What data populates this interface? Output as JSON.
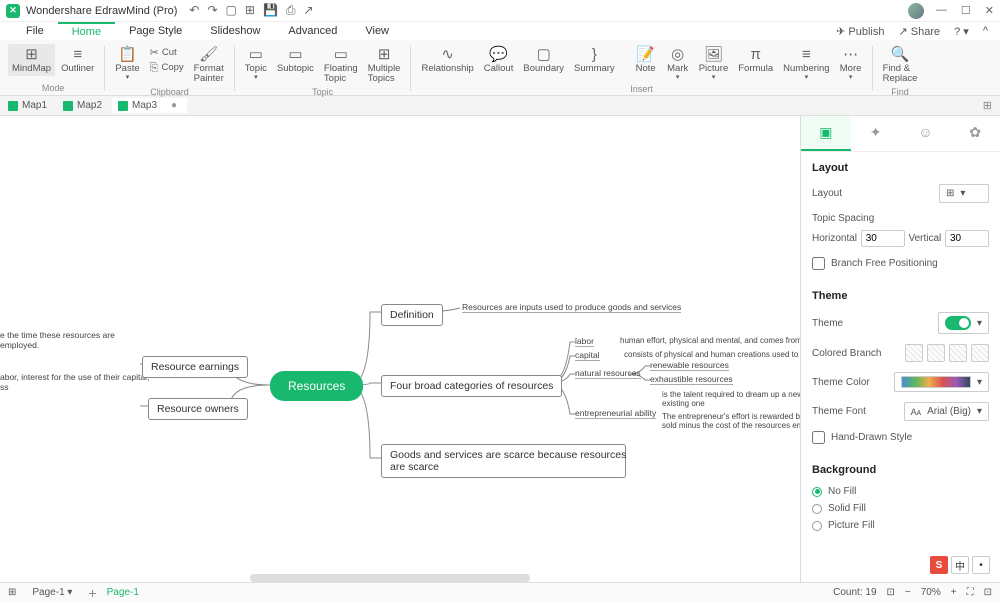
{
  "app": {
    "title": "Wondershare EdrawMind (Pro)"
  },
  "menu": {
    "items": [
      "File",
      "Home",
      "Page Style",
      "Slideshow",
      "Advanced",
      "View"
    ],
    "active": 1,
    "publish": "Publish",
    "share": "Share"
  },
  "ribbon": {
    "mode": {
      "label": "Mode",
      "mindmap": "MindMap",
      "outliner": "Outliner"
    },
    "clipboard": {
      "label": "Clipboard",
      "paste": "Paste",
      "cut": "Cut",
      "copy": "Copy",
      "painter": "Format\nPainter"
    },
    "topic": {
      "label": "Topic",
      "topic": "Topic",
      "subtopic": "Subtopic",
      "floating": "Floating\nTopic",
      "multiple": "Multiple\nTopics"
    },
    "insert": {
      "label": "Insert",
      "relationship": "Relationship",
      "callout": "Callout",
      "boundary": "Boundary",
      "summary": "Summary",
      "note": "Note",
      "mark": "Mark",
      "picture": "Picture",
      "formula": "Formula",
      "numbering": "Numbering",
      "more": "More"
    },
    "find": {
      "label": "Find",
      "find": "Find &\nReplace"
    }
  },
  "tabs": [
    "Map1",
    "Map2",
    "Map3"
  ],
  "mindmap": {
    "center": "Resources",
    "l1": "Resource earnings",
    "l2": "Resource owners",
    "note_l1": "e the time these resources are employed.",
    "note_l2": "abor, interest for the use of their capital,\nss",
    "r1": "Definition",
    "r1_note": "Resources are inputs used to produce goods and services",
    "r2": "Four broad categories of resources",
    "r2_items": {
      "labor": "labor",
      "labor_t": "human effort, physical and mental, and comes from time",
      "capital": "capital",
      "capital_t": "consists of physical and human creations used to produce good",
      "natres": "natural resources",
      "renew": "renewable resources",
      "exhaust": "exhaustible resources",
      "ent": "entrepreneurial ability",
      "ent_t1": "is the talent required to dream up a new product\nexisting one",
      "ent_t2": "The entrepreneur's effort is rewarded by profit, w\nsold minus the cost of the resources employed"
    },
    "r3": "Goods and services are scarce because resources\nare scarce"
  },
  "panel": {
    "layout_h": "Layout",
    "layout": "Layout",
    "spacing": "Topic Spacing",
    "horiz": "Horizontal",
    "horiz_v": "30",
    "vert": "Vertical",
    "vert_v": "30",
    "branchfree": "Branch Free Positioning",
    "theme_h": "Theme",
    "theme": "Theme",
    "colbranch": "Colored Branch",
    "themecolor": "Theme Color",
    "themefont": "Theme Font",
    "themefont_v": "Arial (Big)",
    "hand": "Hand-Drawn Style",
    "bg_h": "Background",
    "nofill": "No Fill",
    "solid": "Solid Fill",
    "picfill": "Picture Fill"
  },
  "status": {
    "page": "Page-1",
    "page2": "Page-1",
    "count": "Count: 19",
    "zoom": "70%"
  }
}
